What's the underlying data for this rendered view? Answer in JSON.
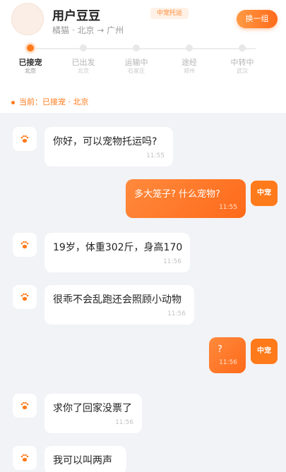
{
  "header": {
    "username": "用户豆豆",
    "route": "橘猫 · 北京 → 广州",
    "service_tag": "中宠托运",
    "switch_button": "换一组"
  },
  "steps": [
    {
      "label": "已接宠",
      "city": "北京",
      "active": true
    },
    {
      "label": "已出发",
      "city": "北京",
      "active": false
    },
    {
      "label": "运输中",
      "city": "石家庄",
      "active": false
    },
    {
      "label": "途经",
      "city": "郑州",
      "active": false
    },
    {
      "label": "中转中",
      "city": "武汉",
      "active": false
    }
  ],
  "current_status": "当前：已接宠 · 北京",
  "messages": [
    {
      "side": "in",
      "text": "你好，可以宠物托运吗?",
      "time": "11:55"
    },
    {
      "side": "out",
      "text": "多大笼子? 什么宠物?",
      "time": "11:55",
      "avatar": "中宠"
    },
    {
      "side": "in",
      "text": "19岁，体重302斤，身高170",
      "time": "11:56"
    },
    {
      "side": "in",
      "text": "很乖不会乱跑还会照顾小动物",
      "time": "11:56"
    },
    {
      "side": "out",
      "text": "?",
      "time": "11:56",
      "avatar": "中宠"
    },
    {
      "side": "in",
      "text": "求你了回家没票了",
      "time": "11:56"
    },
    {
      "side": "in",
      "text": "我可以叫两声",
      "time": ""
    }
  ],
  "icons": {
    "pet_avatar": "paw-icon",
    "accent": "#ff7a1a"
  }
}
